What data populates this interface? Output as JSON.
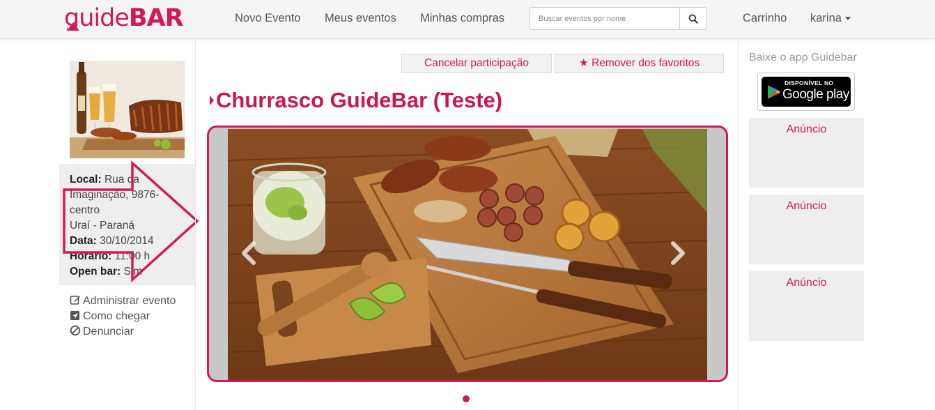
{
  "nav": {
    "logo_part1": "guide",
    "logo_part2": "BAR",
    "links": [
      "Novo Evento",
      "Meus eventos",
      "Minhas compras"
    ],
    "search_placeholder": "Buscar eventos por nome",
    "cart": "Carrinho",
    "user": "karina"
  },
  "event": {
    "title": "Churrasco GuideBar (Teste)",
    "cancel_label": "Cancelar participação",
    "favorite_label": "Remover dos favoritos",
    "local_label": "Local:",
    "local_value": "Rua da Imaginação, 9876- centro",
    "city": "Uraí - Paraná",
    "date_label": "Data:",
    "date_value": "30/10/2014",
    "time_label": "Horário:",
    "time_value": "11:00 h",
    "openbar_label": "Open bar:",
    "openbar_value": "Sim"
  },
  "actions": {
    "manage": "Administrar evento",
    "directions": "Como chegar",
    "report": "Denunciar"
  },
  "sidebar": {
    "app_title": "Baixe o app Guidebar",
    "store_small": "DISPONÍVEL NO",
    "store_big": "Google play",
    "ads": [
      "Anúncio",
      "Anúncio",
      "Anúncio"
    ]
  },
  "colors": {
    "brand": "#d3195a",
    "title": "#c8184f"
  }
}
